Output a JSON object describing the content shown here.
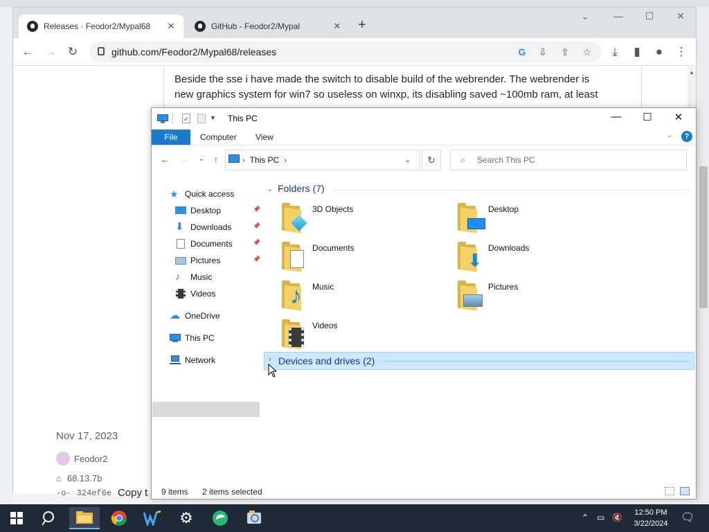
{
  "browser": {
    "tabs": [
      {
        "label": "Releases · Feodor2/Mypal68",
        "active": true
      },
      {
        "label": "GitHub - Feodor2/Mypal",
        "active": false
      }
    ],
    "url": "github.com/Feodor2/Mypal68/releases"
  },
  "github_page": {
    "paragraph_lines": [
      "Beside the sse i have made the switch to disable build of the webrender. The webrender is",
      "new graphics system for win7 so useless on winxp, its disabling saved ~100mb ram, at least"
    ],
    "release_date": "Nov 17, 2023",
    "author": "Feodor2",
    "tag": "68.13.7b",
    "commit": "324ef6e",
    "copy_fragment": "Copy t"
  },
  "explorer": {
    "title": "This PC",
    "ribbon_tabs": [
      "File",
      "Computer",
      "View"
    ],
    "help_label": "?",
    "address": {
      "crumb": "This PC"
    },
    "search_placeholder": "Search This PC",
    "nav": {
      "quick_access": "Quick access",
      "pinned": [
        {
          "label": "Desktop"
        },
        {
          "label": "Downloads"
        },
        {
          "label": "Documents"
        },
        {
          "label": "Pictures"
        }
      ],
      "unpinned": [
        {
          "label": "Music"
        },
        {
          "label": "Videos"
        }
      ],
      "onedrive": "OneDrive",
      "this_pc": "This PC",
      "network": "Network"
    },
    "groups": {
      "folders": "Folders (7)",
      "devices": "Devices and drives (2)"
    },
    "folders": [
      {
        "name": "3D Objects",
        "icon": "3d-objects-icon"
      },
      {
        "name": "Desktop",
        "icon": "desktop-folder-icon"
      },
      {
        "name": "Documents",
        "icon": "documents-folder-icon"
      },
      {
        "name": "Downloads",
        "icon": "downloads-folder-icon"
      },
      {
        "name": "Music",
        "icon": "music-folder-icon"
      },
      {
        "name": "Pictures",
        "icon": "pictures-folder-icon"
      },
      {
        "name": "Videos",
        "icon": "videos-folder-icon"
      }
    ],
    "status": {
      "items": "9 items",
      "selected": "2 items selected"
    }
  },
  "taskbar": {
    "clock_time": "12:50 PM",
    "clock_date": "3/22/2024"
  },
  "colors": {
    "accent": "#1979ca",
    "selection": "#cce8ff",
    "taskbar": "#1f2a38",
    "folder_yellow": "#f3d167"
  }
}
